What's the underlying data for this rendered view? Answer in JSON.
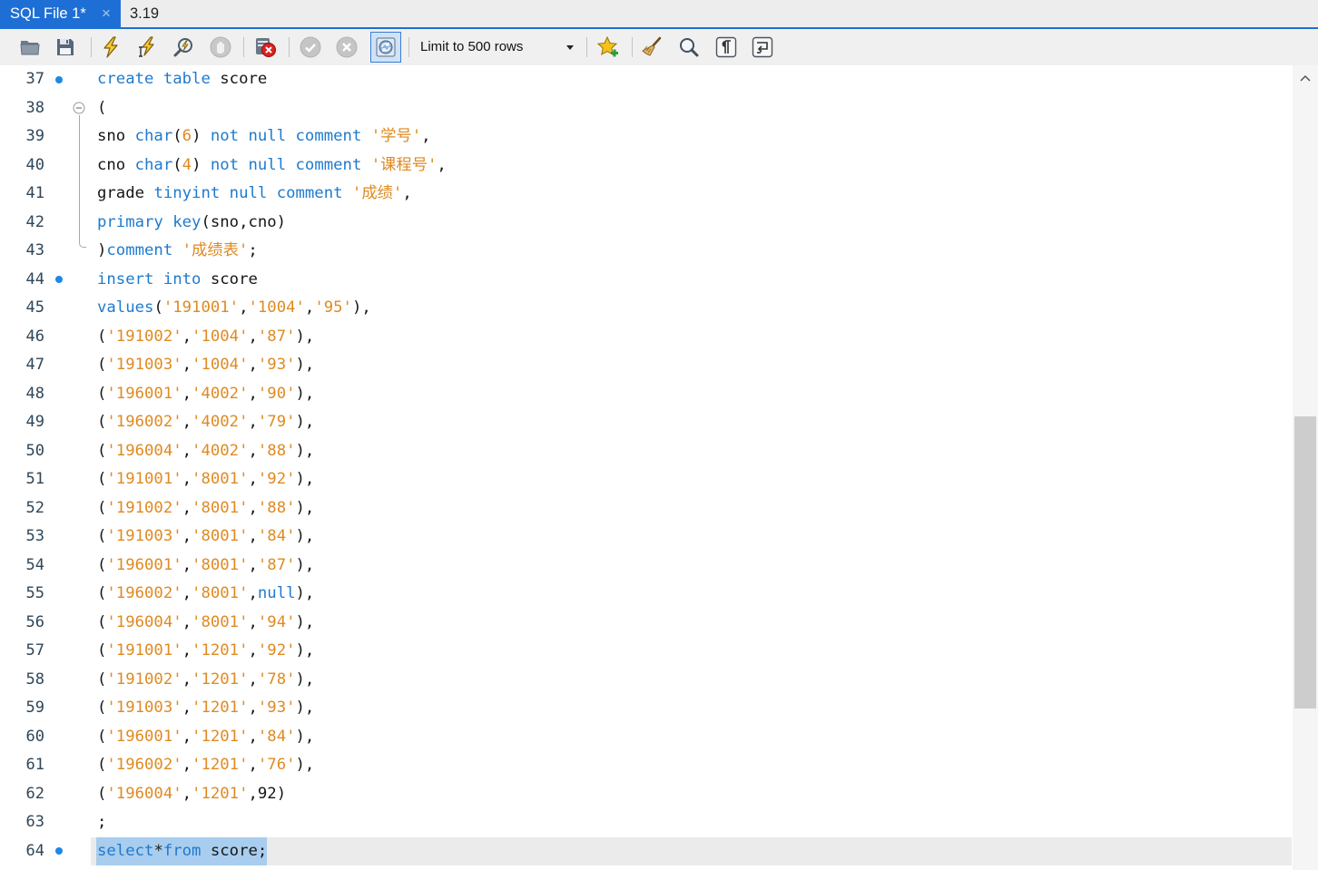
{
  "colors": {
    "accent": "#1e6fd5",
    "keyword": "#1f7acd",
    "string": "#df8a22",
    "identifier": "#161616",
    "marker": "#1e88e5",
    "selection": "#a8cdee",
    "current_line": "#ebebeb"
  },
  "tabs": [
    {
      "label": "SQL File 1*",
      "active": true,
      "close": "×"
    },
    {
      "label": "3.19",
      "active": false
    }
  ],
  "toolbar": {
    "icons": [
      "open-file-icon",
      "save-icon",
      "execute-icon",
      "execute-current-statement-icon",
      "explain-icon",
      "stop-icon",
      "stop-on-error-toggle-icon",
      "commit-icon",
      "rollback-icon",
      "autocommit-toggle-icon",
      "add-snippet-icon",
      "beautify-icon",
      "find-icon",
      "invisible-characters-icon",
      "word-wrap-icon"
    ],
    "limit_select": {
      "value": "Limit to 500 rows"
    }
  },
  "editor": {
    "lines": [
      {
        "number": 37,
        "marker": "statement",
        "tokens": [
          [
            "kw",
            "create "
          ],
          [
            "kw",
            "table"
          ],
          [
            "id",
            " score"
          ]
        ]
      },
      {
        "number": 38,
        "fold": "start",
        "tokens": [
          [
            "p",
            "("
          ]
        ]
      },
      {
        "number": 39,
        "tokens": [
          [
            "id",
            "sno "
          ],
          [
            "kw",
            "char"
          ],
          [
            "p",
            "("
          ],
          [
            "str",
            "6"
          ],
          [
            "p",
            ") "
          ],
          [
            "kw",
            "not null comment"
          ],
          [
            "str",
            " '学号'"
          ],
          [
            "p",
            ","
          ]
        ]
      },
      {
        "number": 40,
        "tokens": [
          [
            "id",
            "cno "
          ],
          [
            "kw",
            "char"
          ],
          [
            "p",
            "("
          ],
          [
            "str",
            "4"
          ],
          [
            "p",
            ") "
          ],
          [
            "kw",
            "not null comment"
          ],
          [
            "str",
            " '课程号'"
          ],
          [
            "p",
            ","
          ]
        ]
      },
      {
        "number": 41,
        "tokens": [
          [
            "id",
            "grade "
          ],
          [
            "kw",
            "tinyint null comment"
          ],
          [
            "str",
            " '成绩'"
          ],
          [
            "p",
            ","
          ]
        ]
      },
      {
        "number": 42,
        "tokens": [
          [
            "kw",
            "primary key"
          ],
          [
            "p",
            "(sno,cno)"
          ]
        ]
      },
      {
        "number": 43,
        "fold": "end",
        "tokens": [
          [
            "p",
            ")"
          ],
          [
            "kw",
            "comment"
          ],
          [
            "str",
            " '成绩表'"
          ],
          [
            "p",
            ";"
          ]
        ]
      },
      {
        "number": 44,
        "marker": "statement",
        "tokens": [
          [
            "kw",
            "insert into"
          ],
          [
            "id",
            " score"
          ]
        ]
      },
      {
        "number": 45,
        "tokens": [
          [
            "kw",
            "values"
          ],
          [
            "p",
            "("
          ],
          [
            "str",
            "'191001'"
          ],
          [
            "p",
            ","
          ],
          [
            "str",
            "'1004'"
          ],
          [
            "p",
            ","
          ],
          [
            "str",
            "'95'"
          ],
          [
            "p",
            "),"
          ]
        ]
      },
      {
        "number": 46,
        "tokens": [
          [
            "p",
            "("
          ],
          [
            "str",
            "'191002'"
          ],
          [
            "p",
            ","
          ],
          [
            "str",
            "'1004'"
          ],
          [
            "p",
            ","
          ],
          [
            "str",
            "'87'"
          ],
          [
            "p",
            "),"
          ]
        ]
      },
      {
        "number": 47,
        "tokens": [
          [
            "p",
            "("
          ],
          [
            "str",
            "'191003'"
          ],
          [
            "p",
            ","
          ],
          [
            "str",
            "'1004'"
          ],
          [
            "p",
            ","
          ],
          [
            "str",
            "'93'"
          ],
          [
            "p",
            "),"
          ]
        ]
      },
      {
        "number": 48,
        "tokens": [
          [
            "p",
            "("
          ],
          [
            "str",
            "'196001'"
          ],
          [
            "p",
            ","
          ],
          [
            "str",
            "'4002'"
          ],
          [
            "p",
            ","
          ],
          [
            "str",
            "'90'"
          ],
          [
            "p",
            "),"
          ]
        ]
      },
      {
        "number": 49,
        "tokens": [
          [
            "p",
            "("
          ],
          [
            "str",
            "'196002'"
          ],
          [
            "p",
            ","
          ],
          [
            "str",
            "'4002'"
          ],
          [
            "p",
            ","
          ],
          [
            "str",
            "'79'"
          ],
          [
            "p",
            "),"
          ]
        ]
      },
      {
        "number": 50,
        "tokens": [
          [
            "p",
            "("
          ],
          [
            "str",
            "'196004'"
          ],
          [
            "p",
            ","
          ],
          [
            "str",
            "'4002'"
          ],
          [
            "p",
            ","
          ],
          [
            "str",
            "'88'"
          ],
          [
            "p",
            "),"
          ]
        ]
      },
      {
        "number": 51,
        "tokens": [
          [
            "p",
            "("
          ],
          [
            "str",
            "'191001'"
          ],
          [
            "p",
            ","
          ],
          [
            "str",
            "'8001'"
          ],
          [
            "p",
            ","
          ],
          [
            "str",
            "'92'"
          ],
          [
            "p",
            "),"
          ]
        ]
      },
      {
        "number": 52,
        "tokens": [
          [
            "p",
            "("
          ],
          [
            "str",
            "'191002'"
          ],
          [
            "p",
            ","
          ],
          [
            "str",
            "'8001'"
          ],
          [
            "p",
            ","
          ],
          [
            "str",
            "'88'"
          ],
          [
            "p",
            "),"
          ]
        ]
      },
      {
        "number": 53,
        "tokens": [
          [
            "p",
            "("
          ],
          [
            "str",
            "'191003'"
          ],
          [
            "p",
            ","
          ],
          [
            "str",
            "'8001'"
          ],
          [
            "p",
            ","
          ],
          [
            "str",
            "'84'"
          ],
          [
            "p",
            "),"
          ]
        ]
      },
      {
        "number": 54,
        "tokens": [
          [
            "p",
            "("
          ],
          [
            "str",
            "'196001'"
          ],
          [
            "p",
            ","
          ],
          [
            "str",
            "'8001'"
          ],
          [
            "p",
            ","
          ],
          [
            "str",
            "'87'"
          ],
          [
            "p",
            "),"
          ]
        ]
      },
      {
        "number": 55,
        "tokens": [
          [
            "p",
            "("
          ],
          [
            "str",
            "'196002'"
          ],
          [
            "p",
            ","
          ],
          [
            "str",
            "'8001'"
          ],
          [
            "p",
            ","
          ],
          [
            "kw",
            "null"
          ],
          [
            "p",
            "),"
          ]
        ]
      },
      {
        "number": 56,
        "tokens": [
          [
            "p",
            "("
          ],
          [
            "str",
            "'196004'"
          ],
          [
            "p",
            ","
          ],
          [
            "str",
            "'8001'"
          ],
          [
            "p",
            ","
          ],
          [
            "str",
            "'94'"
          ],
          [
            "p",
            "),"
          ]
        ]
      },
      {
        "number": 57,
        "tokens": [
          [
            "p",
            "("
          ],
          [
            "str",
            "'191001'"
          ],
          [
            "p",
            ","
          ],
          [
            "str",
            "'1201'"
          ],
          [
            "p",
            ","
          ],
          [
            "str",
            "'92'"
          ],
          [
            "p",
            "),"
          ]
        ]
      },
      {
        "number": 58,
        "tokens": [
          [
            "p",
            "("
          ],
          [
            "str",
            "'191002'"
          ],
          [
            "p",
            ","
          ],
          [
            "str",
            "'1201'"
          ],
          [
            "p",
            ","
          ],
          [
            "str",
            "'78'"
          ],
          [
            "p",
            "),"
          ]
        ]
      },
      {
        "number": 59,
        "tokens": [
          [
            "p",
            "("
          ],
          [
            "str",
            "'191003'"
          ],
          [
            "p",
            ","
          ],
          [
            "str",
            "'1201'"
          ],
          [
            "p",
            ","
          ],
          [
            "str",
            "'93'"
          ],
          [
            "p",
            "),"
          ]
        ]
      },
      {
        "number": 60,
        "tokens": [
          [
            "p",
            "("
          ],
          [
            "str",
            "'196001'"
          ],
          [
            "p",
            ","
          ],
          [
            "str",
            "'1201'"
          ],
          [
            "p",
            ","
          ],
          [
            "str",
            "'84'"
          ],
          [
            "p",
            "),"
          ]
        ]
      },
      {
        "number": 61,
        "tokens": [
          [
            "p",
            "("
          ],
          [
            "str",
            "'196002'"
          ],
          [
            "p",
            ","
          ],
          [
            "str",
            "'1201'"
          ],
          [
            "p",
            ","
          ],
          [
            "str",
            "'76'"
          ],
          [
            "p",
            "),"
          ]
        ]
      },
      {
        "number": 62,
        "tokens": [
          [
            "p",
            "("
          ],
          [
            "str",
            "'196004'"
          ],
          [
            "p",
            ","
          ],
          [
            "str",
            "'1201'"
          ],
          [
            "p",
            ",92)"
          ]
        ]
      },
      {
        "number": 63,
        "tokens": [
          [
            "p",
            ";"
          ]
        ]
      },
      {
        "number": 64,
        "marker": "statement",
        "current": true,
        "selected": true,
        "tokens": [
          [
            "kw",
            "select"
          ],
          [
            "p",
            "*"
          ],
          [
            "kw",
            "from"
          ],
          [
            "id",
            " score"
          ],
          [
            "p",
            ";"
          ]
        ]
      }
    ]
  }
}
